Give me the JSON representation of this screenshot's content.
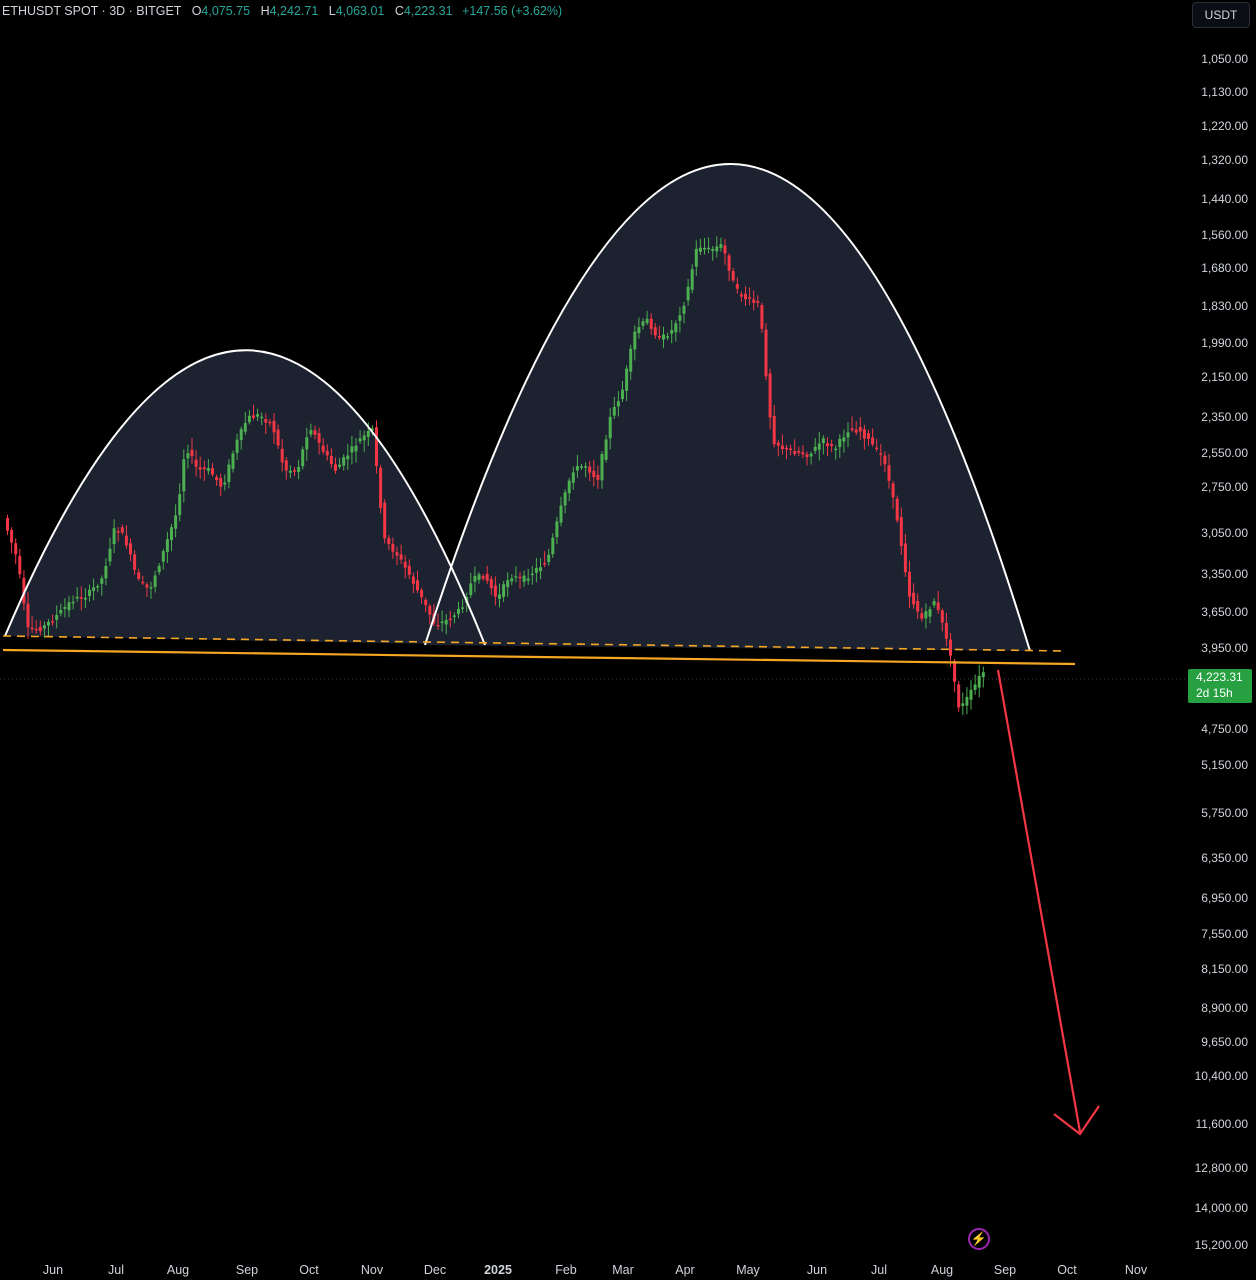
{
  "header": {
    "symbol": "ETHUSDT SPOT · 3D · BITGET",
    "open_label": "O",
    "open": "4,075.75",
    "high_label": "H",
    "high": "4,242.71",
    "low_label": "L",
    "low": "4,063.01",
    "close_label": "C",
    "close": "4,223.31",
    "change": "+147.56 (+3.62%)"
  },
  "currency": "USDT",
  "price_badge": {
    "price": "4,223.31",
    "countdown": "2d 15h"
  },
  "colors": {
    "up": "#4caf50",
    "down": "#f23645",
    "arc": "#ffffff",
    "arc_fill": "#1c2230",
    "neckline": "#f5a623",
    "arrow": "#f23645",
    "background": "#000000"
  },
  "chart_data": {
    "type": "candlestick",
    "y_axis_inverted": true,
    "y_scale": "log",
    "y_tick_labels": [
      "1,050.00",
      "1,130.00",
      "1,220.00",
      "1,320.00",
      "1,440.00",
      "1,560.00",
      "1,680.00",
      "1,830.00",
      "1,990.00",
      "2,150.00",
      "2,350.00",
      "2,550.00",
      "2,750.00",
      "3,050.00",
      "3,350.00",
      "3,650.00",
      "3,950.00",
      "4,750.00",
      "5,150.00",
      "5,750.00",
      "6,350.00",
      "6,950.00",
      "7,550.00",
      "8,150.00",
      "8,900.00",
      "9,650.00",
      "10,400.00",
      "11,600.00",
      "12,800.00",
      "14,000.00",
      "15,200.00"
    ],
    "x_tick_labels": [
      "Jun",
      "Jul",
      "Aug",
      "Sep",
      "Oct",
      "Nov",
      "Dec",
      "2025",
      "Feb",
      "Mar",
      "Apr",
      "May",
      "Jun",
      "Jul",
      "Aug",
      "Sep",
      "Oct",
      "Nov"
    ],
    "last_price": 4223.31,
    "annotations": [
      "rounded-arc-left",
      "rounded-arc-right",
      "neckline-dashed",
      "neckline-solid",
      "projection-arrow-down"
    ]
  }
}
